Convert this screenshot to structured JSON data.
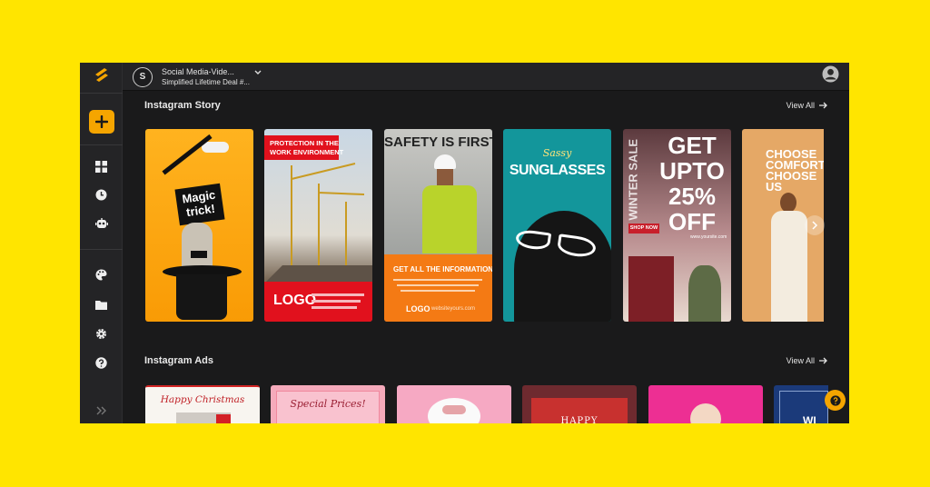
{
  "colors": {
    "page_bg": "#FFE500",
    "app_bg": "#1a1a1b",
    "sidebar_bg": "#242426",
    "accent": "#F5A500"
  },
  "sidebar": {
    "items": [
      {
        "name": "logo",
        "icon": "simplified-logo-icon"
      },
      {
        "name": "create",
        "icon": "plus-icon"
      },
      {
        "name": "dashboard",
        "icon": "grid-icon"
      },
      {
        "name": "recent",
        "icon": "clock-icon"
      },
      {
        "name": "ai-assistant",
        "icon": "robot-icon"
      },
      {
        "name": "brand-kit",
        "icon": "palette-icon"
      },
      {
        "name": "folders",
        "icon": "folder-icon"
      },
      {
        "name": "settings",
        "icon": "gear-icon"
      },
      {
        "name": "help",
        "icon": "help-icon"
      },
      {
        "name": "expand",
        "icon": "double-chevron-icon"
      }
    ]
  },
  "topbar": {
    "workspace_initial": "S",
    "workspace_name": "Social Media-Vide...",
    "workspace_sub": "Simplified Lifetime Deal #..."
  },
  "sections": {
    "story": {
      "title": "Instagram Story",
      "view_all": "View All"
    },
    "ads": {
      "title": "Instagram Ads",
      "view_all": "View All"
    }
  },
  "story_cards": {
    "magic": {
      "line1": "Magic",
      "line2": "trick!"
    },
    "protection": {
      "headline_1": "PROTECTION IN THE",
      "headline_2": "WORK ENVIRONMENT",
      "logo": "LOGO"
    },
    "safety": {
      "headline": "SAFETY IS FIRST",
      "cta": "GET ALL THE INFORMATION",
      "logo": "LOGO",
      "url": "websiteyours.com"
    },
    "sunglasses": {
      "script": "Sassy",
      "headline": "SUNGLASSES"
    },
    "sale": {
      "vertical": "WINTER SALE",
      "line1": "GET",
      "line2": "UPTO",
      "line3": "25%",
      "line4": "OFF",
      "cta": "SHOP NOW",
      "url": "www.yoursite.com"
    },
    "comfort": {
      "line1": "CHOOSE",
      "line2": "COMFORT",
      "line3": "CHOOSE",
      "line4": "US"
    }
  },
  "ad_cards": {
    "christmas": {
      "text": "Happy Christmas"
    },
    "special": {
      "text": "Special Prices!"
    },
    "happy": {
      "text": "HAPPY"
    },
    "wi": {
      "text": "WI"
    }
  }
}
